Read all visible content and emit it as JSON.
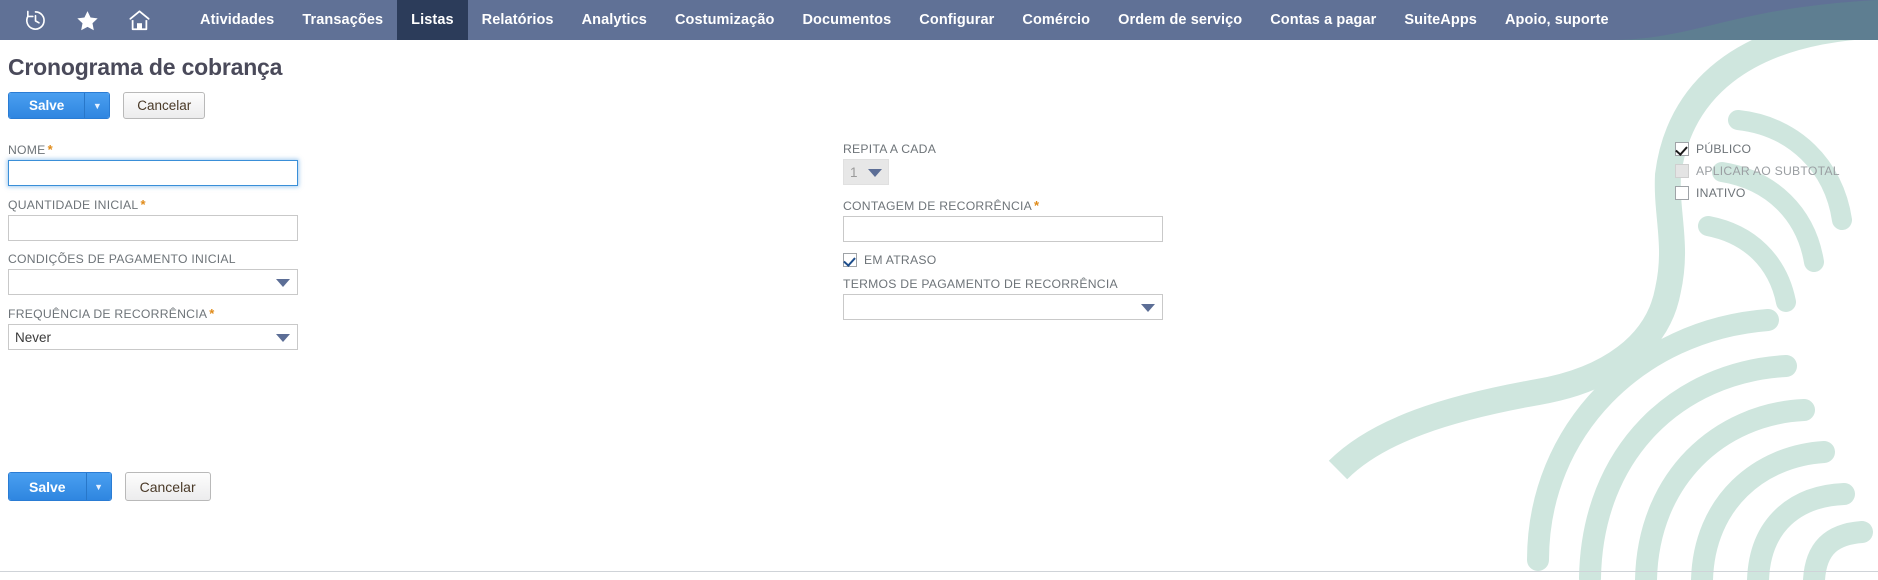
{
  "navbar": {
    "icons": [
      {
        "name": "recent-history-icon",
        "glyph": "history"
      },
      {
        "name": "favorites-star-icon",
        "glyph": "star"
      },
      {
        "name": "home-icon",
        "glyph": "home"
      }
    ],
    "items": [
      {
        "label": "Atividades",
        "active": false
      },
      {
        "label": "Transações",
        "active": false
      },
      {
        "label": "Listas",
        "active": true
      },
      {
        "label": "Relatórios",
        "active": false
      },
      {
        "label": "Analytics",
        "active": false
      },
      {
        "label": "Costumização",
        "active": false
      },
      {
        "label": "Documentos",
        "active": false
      },
      {
        "label": "Configurar",
        "active": false
      },
      {
        "label": "Comércio",
        "active": false
      },
      {
        "label": "Ordem de serviço",
        "active": false
      },
      {
        "label": "Contas a pagar",
        "active": false
      },
      {
        "label": "SuiteApps",
        "active": false
      },
      {
        "label": "Apoio, suporte",
        "active": false
      }
    ],
    "background_color": "#607196",
    "active_color": "#2c3c5a",
    "curve_color": "#5e8090"
  },
  "page": {
    "title": "Cronograma de cobrança"
  },
  "toolbar_top": {
    "save_label": "Salve",
    "save_caret": "▼",
    "cancel_label": "Cancelar"
  },
  "toolbar_bottom": {
    "save_label": "Salve",
    "save_caret": "▼",
    "cancel_label": "Cancelar"
  },
  "form": {
    "left_column": [
      {
        "name": "nome",
        "label": "NOME",
        "required": true,
        "type": "text",
        "value": "",
        "focused": true
      },
      {
        "name": "quantidade-inicial",
        "label": "QUANTIDADE INICIAL",
        "required": true,
        "type": "text",
        "value": "",
        "focused": false
      },
      {
        "name": "condicoes-de-pagamento-inicial",
        "label": "CONDIÇÕES DE PAGAMENTO INICIAL",
        "required": false,
        "type": "select",
        "value": "",
        "disabled": false
      },
      {
        "name": "frequencia-de-recorrencia",
        "label": "FREQUÊNCIA DE RECORRÊNCIA",
        "required": true,
        "type": "select",
        "value": "Never",
        "disabled": false
      }
    ],
    "middle_column": [
      {
        "name": "repita-a-cada",
        "label": "REPITA A CADA",
        "required": false,
        "type": "select-narrow",
        "value": "1",
        "disabled": true
      },
      {
        "name": "contagem-de-recorrencia",
        "label": "CONTAGEM DE RECORRÊNCIA",
        "required": true,
        "type": "text",
        "value": "",
        "focused": false
      },
      {
        "name": "em-atraso",
        "label": "EM ATRASO",
        "type": "checkbox",
        "checked": true,
        "disabled": false
      },
      {
        "name": "termos-de-pagamento-de-recorrencia",
        "label": "TERMOS DE PAGAMENTO DE RECORRÊNCIA",
        "required": false,
        "type": "select",
        "value": "",
        "disabled": false
      }
    ],
    "right_column": [
      {
        "name": "publico",
        "label": "PÚBLICO",
        "type": "checkbox",
        "checked": true,
        "disabled": false
      },
      {
        "name": "aplicar-ao-subtotal",
        "label": "APLICAR AO SUBTOTAL",
        "type": "checkbox",
        "checked": false,
        "disabled": true
      },
      {
        "name": "inativo",
        "label": "INATIVO",
        "type": "checkbox",
        "checked": false,
        "disabled": false
      }
    ]
  },
  "colors": {
    "nav_background": "#607196",
    "nav_active": "#2c3c5a",
    "primary_button": "#2f86e0",
    "required_asterisk": "#e08b19",
    "label_text": "#6e7479",
    "title_text": "#4a4a5a",
    "watermark": "#cfe6de"
  }
}
